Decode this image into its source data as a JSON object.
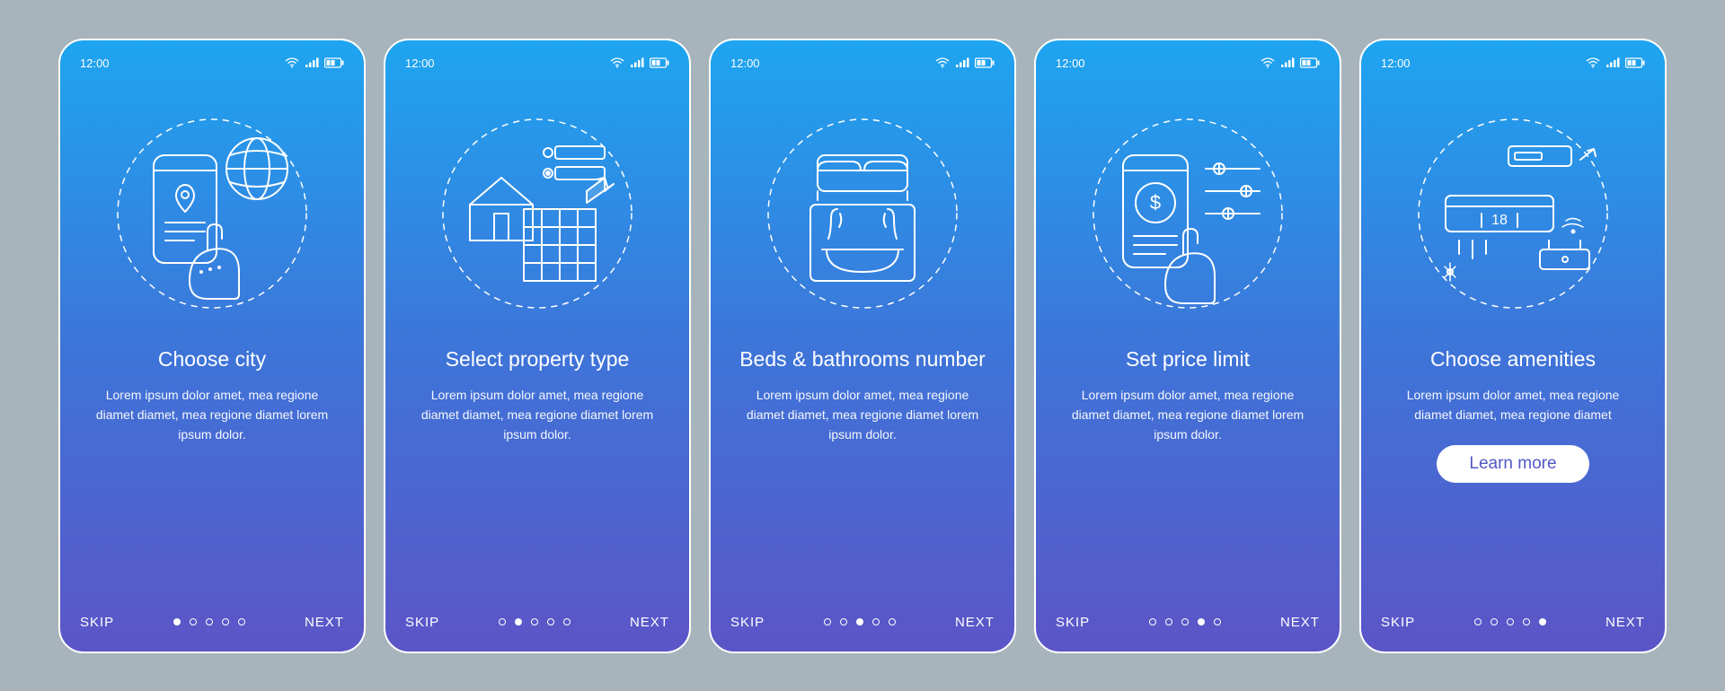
{
  "status_time": "12:00",
  "nav": {
    "skip": "SKIP",
    "next": "NEXT",
    "cta": "Learn more"
  },
  "lorem3": "Lorem ipsum dolor amet, mea regione diamet diamet, mea regione diamet lorem ipsum dolor.",
  "lorem2": "Lorem ipsum dolor amet, mea regione diamet diamet, mea regione diamet",
  "screens": [
    {
      "title": "Choose city",
      "desc_key": "lorem3",
      "active_dot": 0,
      "cta": false
    },
    {
      "title": "Select property type",
      "desc_key": "lorem3",
      "active_dot": 1,
      "cta": false
    },
    {
      "title": "Beds & bathrooms number",
      "desc_key": "lorem3",
      "active_dot": 2,
      "cta": false
    },
    {
      "title": "Set price limit",
      "desc_key": "lorem3",
      "active_dot": 3,
      "cta": false
    },
    {
      "title": "Choose amenities",
      "desc_key": "lorem2",
      "active_dot": 4,
      "cta": true
    }
  ],
  "icons": {
    "0": "choose-city-icon",
    "1": "property-type-icon",
    "2": "beds-bathrooms-icon",
    "3": "price-limit-icon",
    "4": "amenities-icon"
  },
  "amenities_temp": "18"
}
